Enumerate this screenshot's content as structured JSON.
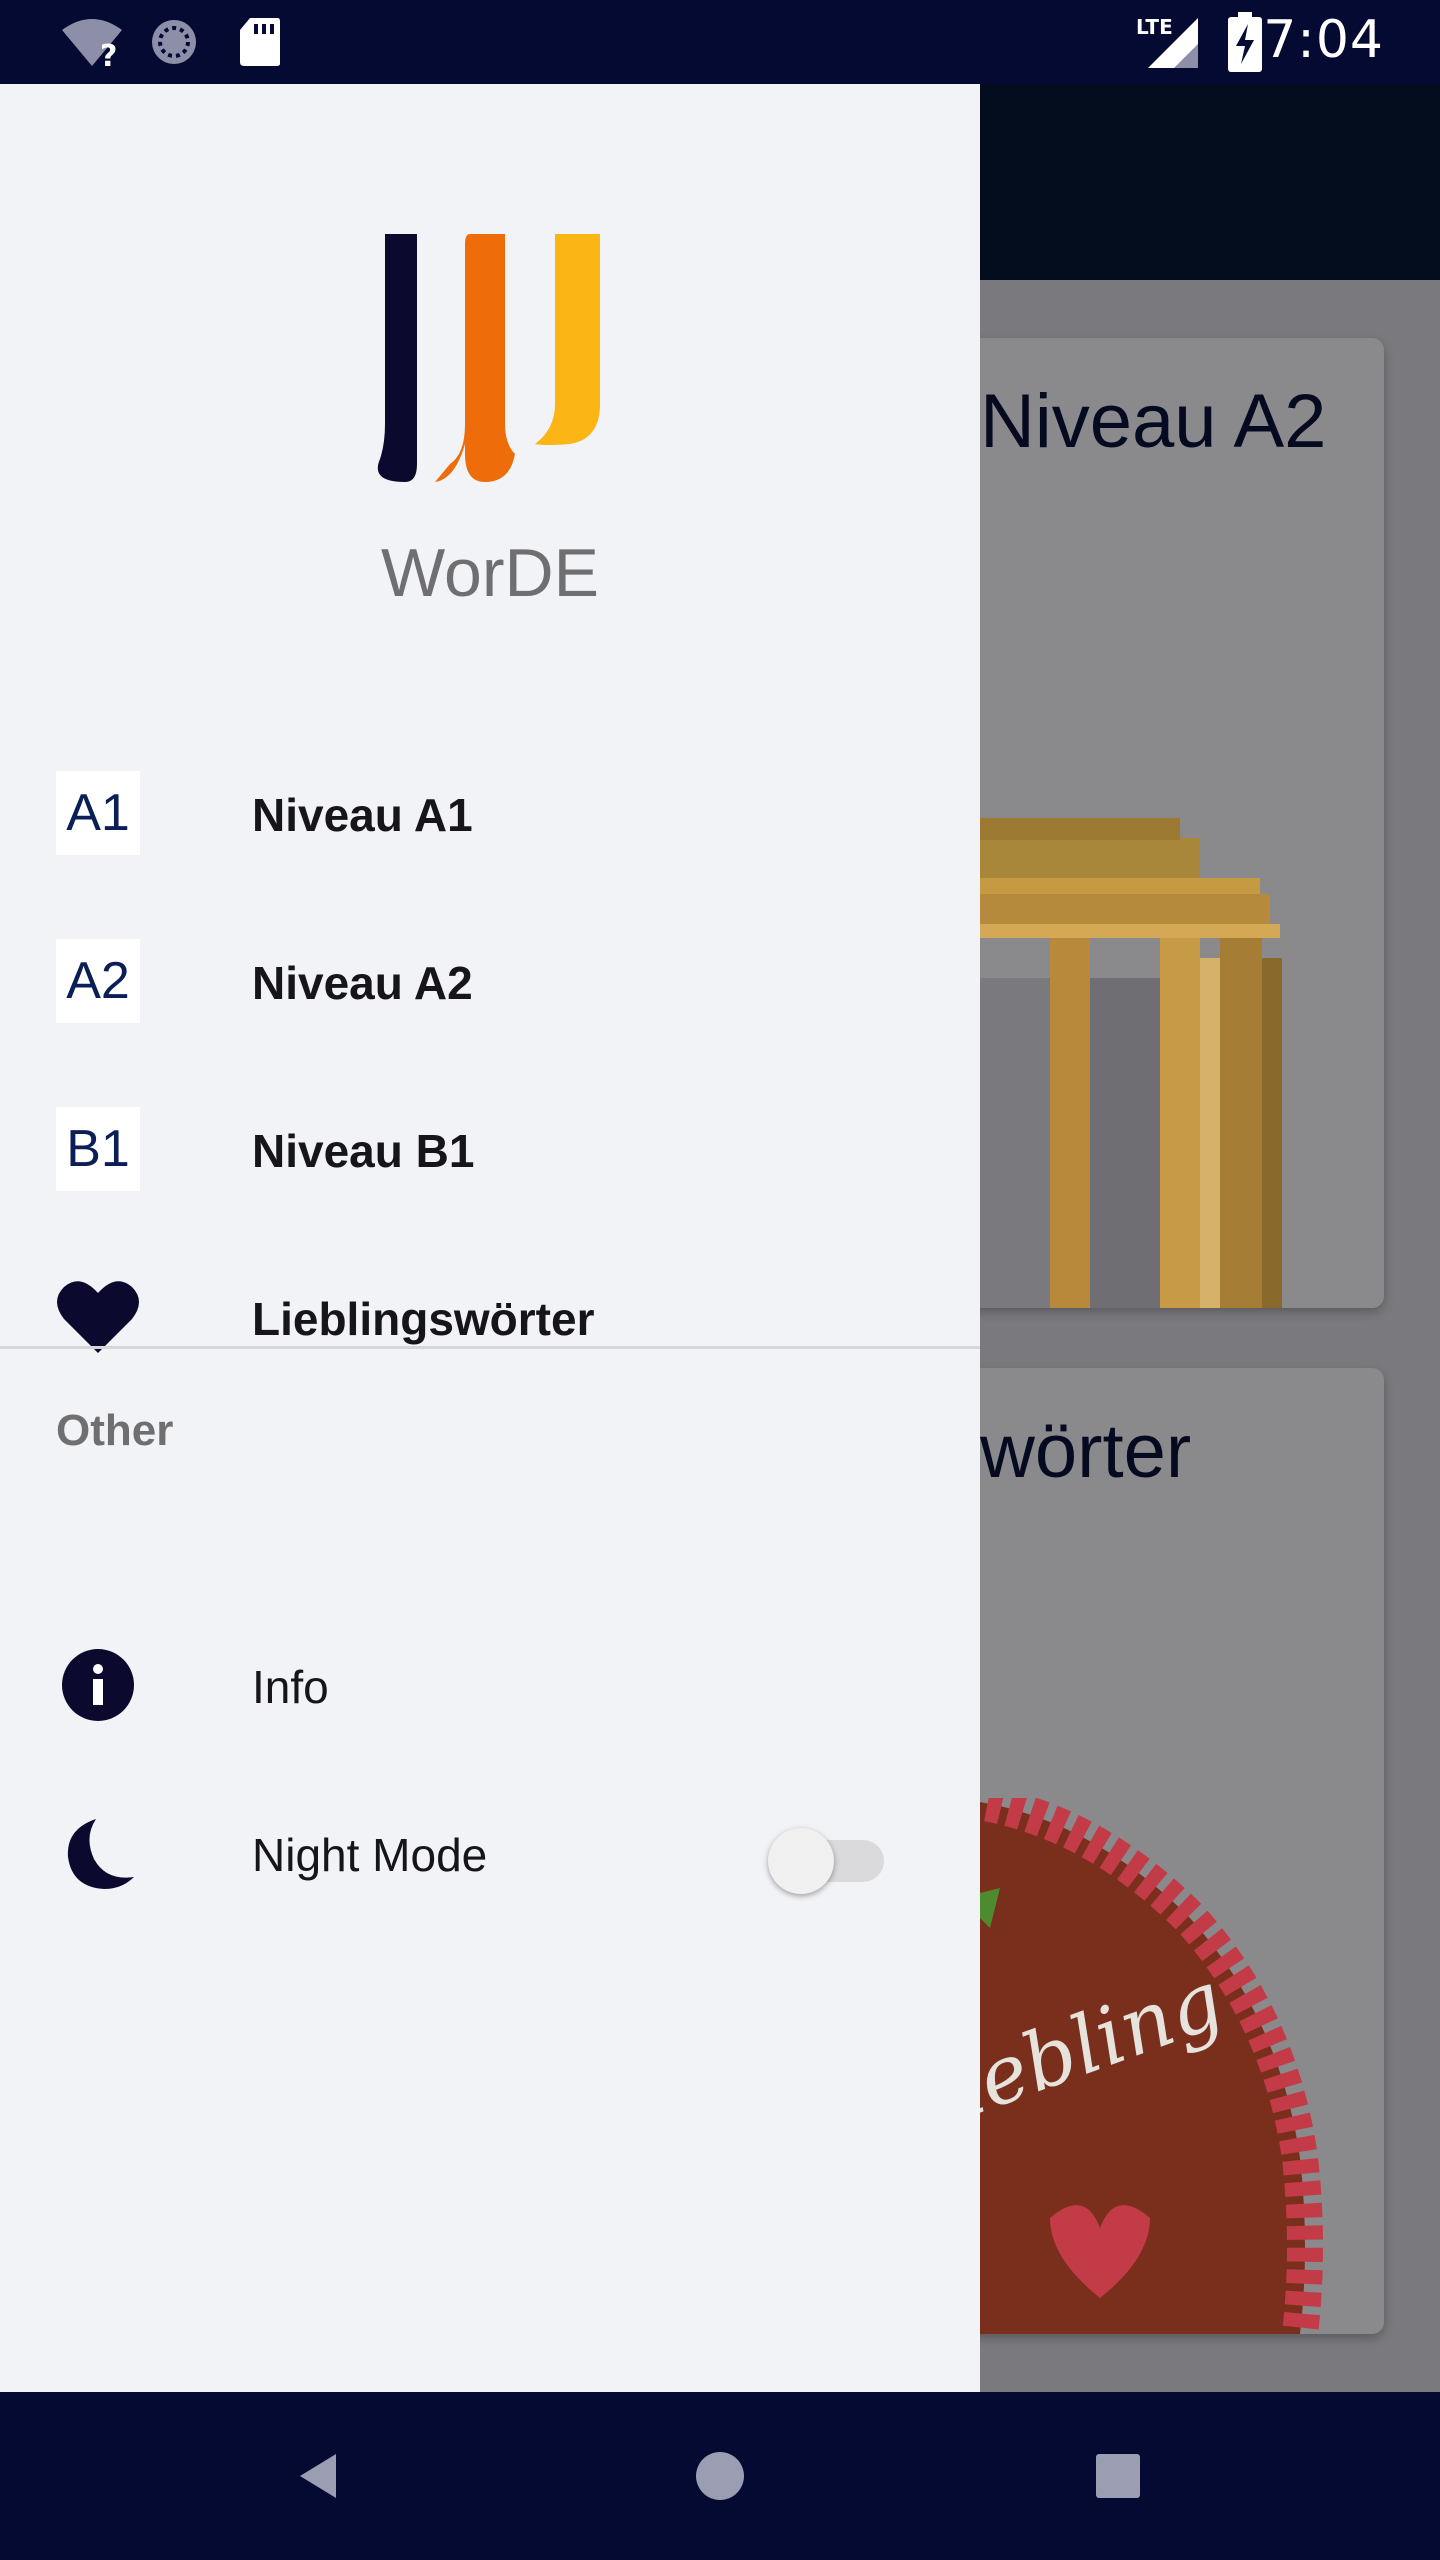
{
  "status_bar": {
    "time": "7:04",
    "network_label": "LTE",
    "icons": [
      "wifi-unknown-icon",
      "sync-icon",
      "sd-card-icon",
      "lte-signal-icon",
      "battery-charging-icon"
    ]
  },
  "background": {
    "cards": [
      {
        "title": "Niveau A2",
        "image": "brandenburg-gate-image"
      },
      {
        "title": "Lieblingswörter",
        "image": "gingerbread-heart-image"
      }
    ],
    "image_text": "Liebling"
  },
  "drawer": {
    "app_name": "WorDE",
    "logo_colors": [
      "#0b0a2e",
      "#ee6c0a",
      "#fbb515"
    ],
    "levels": [
      {
        "badge": "A1",
        "label": "Niveau A1"
      },
      {
        "badge": "A2",
        "label": "Niveau A2"
      },
      {
        "badge": "B1",
        "label": "Niveau B1"
      }
    ],
    "favorites": {
      "label": "Lieblingswörter",
      "icon": "heart-icon"
    },
    "other_section": {
      "header": "Other",
      "info": {
        "label": "Info",
        "icon": "info-icon"
      },
      "night_mode": {
        "label": "Night Mode",
        "icon": "moon-icon",
        "enabled": false
      }
    }
  },
  "nav_bar": {
    "buttons": [
      "back-icon",
      "home-icon",
      "recents-icon"
    ]
  },
  "colors": {
    "status_bar": "#050a33",
    "drawer_bg": "#f2f3f7",
    "icon_navy": "#0b0a2e",
    "badge_text": "#0b1f56"
  }
}
